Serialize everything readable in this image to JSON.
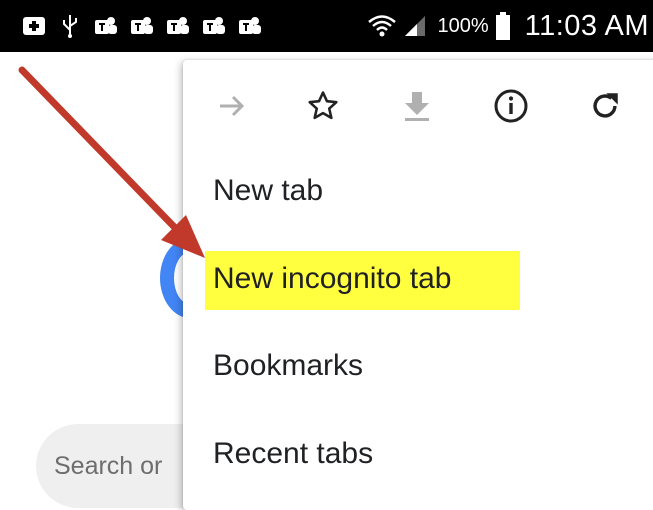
{
  "status_bar": {
    "battery_text": "100%",
    "time": "11:03 AM",
    "icons": [
      "add-box-icon",
      "usb-icon",
      "teams-icon",
      "teams-icon",
      "teams-icon",
      "teams-icon",
      "teams-icon",
      "wifi-icon",
      "signal-icon",
      "battery-icon"
    ]
  },
  "page": {
    "search_placeholder": "Search or"
  },
  "menu": {
    "toolbar": [
      "forward-icon",
      "star-icon",
      "download-icon",
      "info-icon",
      "refresh-icon"
    ],
    "items": [
      {
        "label": "New tab"
      },
      {
        "label": "New incognito tab"
      },
      {
        "label": "Bookmarks"
      },
      {
        "label": "Recent tabs"
      }
    ],
    "highlight_color": "#ffff3f"
  },
  "annotation": {
    "arrow_color": "#c1392b"
  }
}
